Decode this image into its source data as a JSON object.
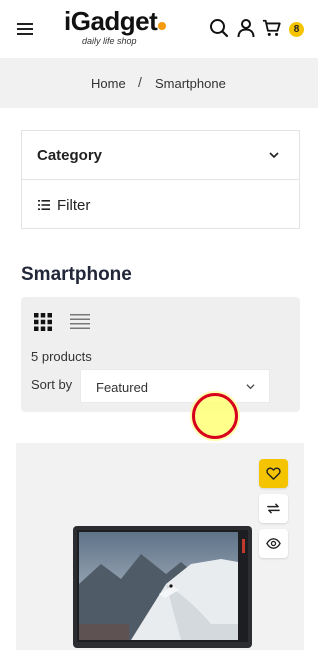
{
  "header": {
    "logo_text": "iGadget",
    "logo_tagline": "daily life  shop",
    "cart_count": "8",
    "brand_color": "#f59a0c",
    "badge_color": "#f5c400"
  },
  "breadcrumb": {
    "home": "Home",
    "separator": "/",
    "current": "Smartphone"
  },
  "filters": {
    "category_label": "Category",
    "filter_label": "Filter"
  },
  "page": {
    "title": "Smartphone"
  },
  "toolbar": {
    "product_count": "5 products",
    "sort_label": "Sort by",
    "sort_value": "Featured"
  }
}
